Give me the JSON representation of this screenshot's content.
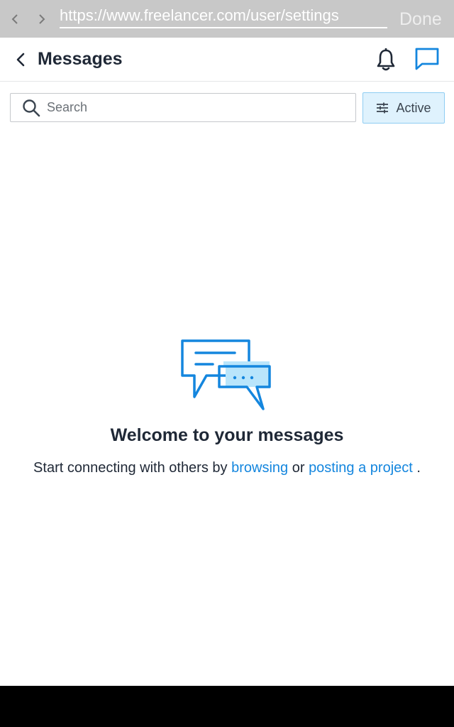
{
  "browser": {
    "url": "https://www.freelancer.com/user/settings",
    "done_label": "Done"
  },
  "header": {
    "title": "Messages"
  },
  "search": {
    "placeholder": "Search",
    "value": ""
  },
  "filter": {
    "label": "Active"
  },
  "empty_state": {
    "title": "Welcome to your messages",
    "text_before": "Start connecting with others by",
    "link_browse": "browsing",
    "text_middle": "or",
    "link_post": "posting a project",
    "text_after": "."
  },
  "colors": {
    "accent": "#1486de",
    "filter_bg": "#dff2fd",
    "text_dark": "#1f2836"
  },
  "icons": [
    "chevron-left-icon",
    "chevron-right-icon",
    "back-arrow-icon",
    "bell-icon",
    "chat-icon",
    "search-icon",
    "sliders-icon",
    "messages-illustration"
  ]
}
